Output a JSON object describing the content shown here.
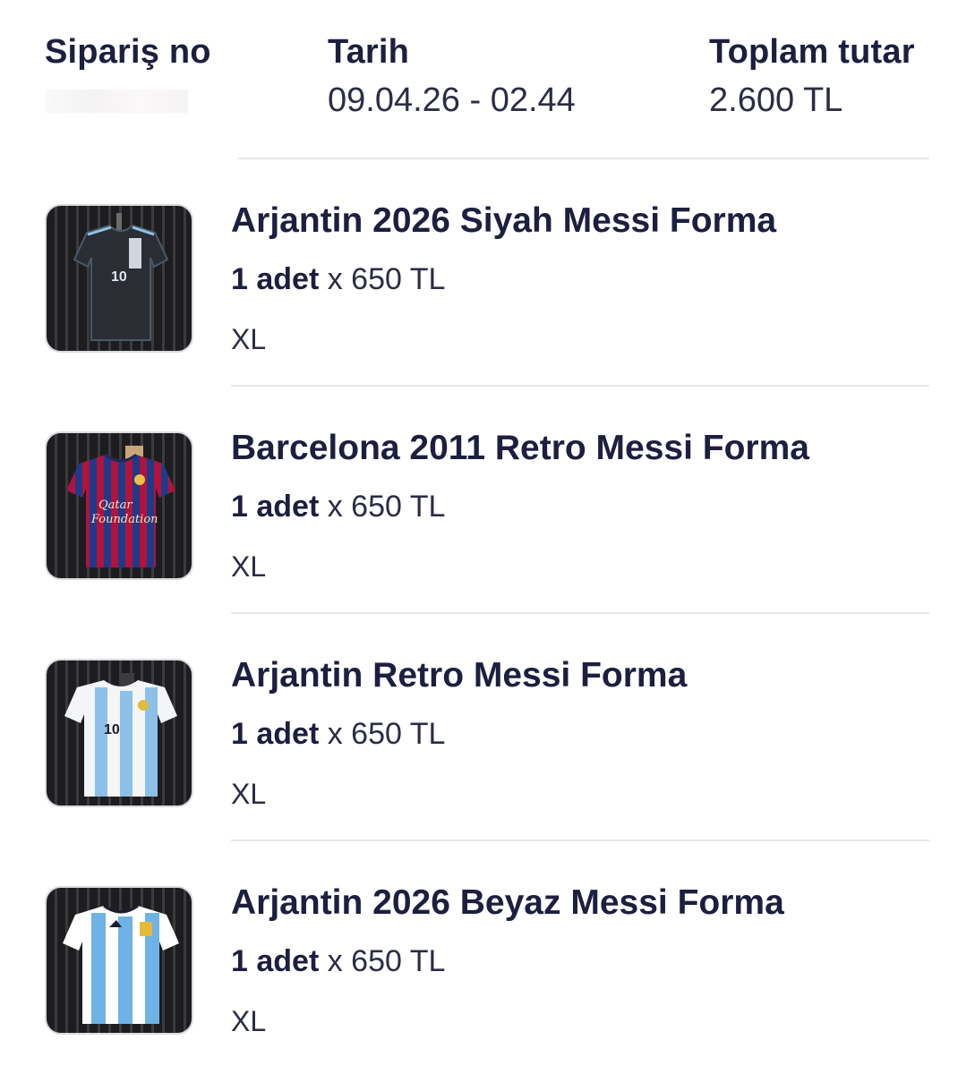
{
  "order": {
    "order_no_label": "Sipariş no",
    "order_no_value": "",
    "date_label": "Tarih",
    "date_value": "09.04.26 - 02.44",
    "total_label": "Toplam tutar",
    "total_value": "2.600 TL"
  },
  "items": [
    {
      "title": "Arjantin 2026 Siyah Messi Forma",
      "qty": "1 adet",
      "sep": "x",
      "price": "650 TL",
      "size": "XL",
      "image": "black-jersey-image"
    },
    {
      "title": "Barcelona 2011 Retro Messi Forma",
      "qty": "1 adet",
      "sep": "x",
      "price": "650 TL",
      "size": "XL",
      "image": "barcelona-jersey-image"
    },
    {
      "title": "Arjantin Retro Messi Forma",
      "qty": "1 adet",
      "sep": "x",
      "price": "650 TL",
      "size": "XL",
      "image": "argentina-retro-jersey-image"
    },
    {
      "title": "Arjantin 2026 Beyaz Messi Forma",
      "qty": "1 adet",
      "sep": "x",
      "price": "650 TL",
      "size": "XL",
      "image": "argentina-white-jersey-image"
    }
  ],
  "colors": {
    "text_primary": "#1c1f3f",
    "divider": "#e6e7ec"
  }
}
